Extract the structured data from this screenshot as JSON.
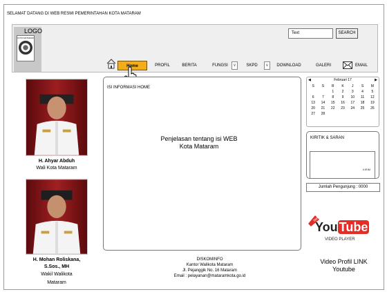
{
  "header": {
    "welcome": "SELAMAT DATANG DI WEB RESMI  PEMERINTAHAN KOTA MATARAM",
    "logo_label": "LOGO",
    "seal_text": "KOTA MATARAM"
  },
  "search": {
    "value": "Text",
    "button": "SEARCH"
  },
  "nav": {
    "home": "Home",
    "profil": "PROFIL",
    "berita": "BERITA",
    "fungsi": "FUNGSI",
    "skpd": "SKPD",
    "download": "DOWNLOAD",
    "galeri": "GALERI",
    "email": "EMAIL"
  },
  "sidebar_left": {
    "mayor_name": "H. Ahyar Abduh",
    "mayor_title": "Wali Kota Mataram",
    "vice_name_1": "H. Mohan Roliskana,",
    "vice_name_2": "S.Sos., MH",
    "vice_title_1": "Wakil Walikota",
    "vice_title_2": "Mataram"
  },
  "content": {
    "title": "ISI INFORMASI HOME",
    "body_1": "Penjelasan tentang isi WEB",
    "body_2": "Kota Mataram"
  },
  "footer": {
    "line1": "DISKOMINFO",
    "line2": "Kantor Walikota Mataram",
    "line3": "Jl. Pejanggik No. 16 Mataram",
    "line4": "Email : pelayanan@mataramkota.go.id"
  },
  "calendar": {
    "prev": "◀",
    "month": "Februari 17",
    "next": "▶",
    "weekdays": [
      "S",
      "S",
      "R",
      "K",
      "J",
      "S",
      "M"
    ],
    "days": [
      "",
      "",
      "1",
      "2",
      "3",
      "4",
      "5",
      "6",
      "7",
      "8",
      "9",
      "10",
      "11",
      "12",
      "13",
      "14",
      "15",
      "16",
      "17",
      "18",
      "19",
      "20",
      "21",
      "22",
      "23",
      "24",
      "25",
      "26",
      "27",
      "28",
      "",
      "",
      "",
      "",
      ""
    ]
  },
  "kritik": {
    "title": "KIRITIK & SARAN",
    "button": "KIRIM"
  },
  "visitor": {
    "label": "Jumlah Pengunjung : 0000"
  },
  "youtube": {
    "badge": "New",
    "you": "You",
    "tube": "Tube",
    "player": "VIDEO PLAYER",
    "label_1": "Video Profil LINK",
    "label_2": "Youtube"
  },
  "colors": {
    "home_tab": "#f2ad1a",
    "youtube_red": "#e52d27"
  }
}
